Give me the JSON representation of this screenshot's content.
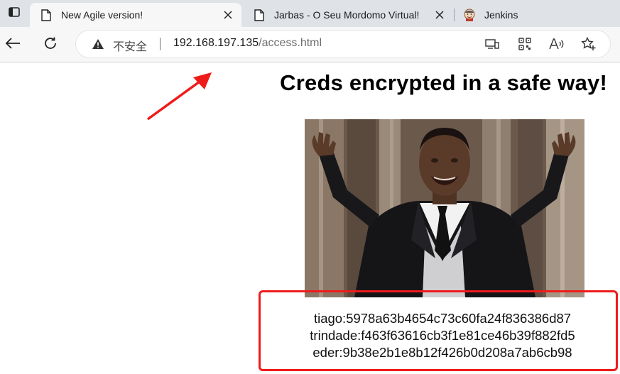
{
  "browser": {
    "tabs": [
      {
        "title": "New Agile version!",
        "active": true,
        "favicon": "page-icon"
      },
      {
        "title": "Jarbas - O Seu Mordomo Virtual!",
        "active": false,
        "favicon": "page-icon"
      },
      {
        "title": "Jenkins",
        "active": false,
        "favicon": "jenkins-icon"
      }
    ],
    "security_label": "不安全",
    "url_host": "192.168.197.135",
    "url_path": "/access.html"
  },
  "page": {
    "heading": "Creds encrypted in a safe way!",
    "image_subject": "man in tuxedo with raised arms",
    "credentials": [
      "tiago:5978a63b4654c73c60fa24f836386d87",
      "trindade:f463f63616cb3f1e81ce46b39f882fd5",
      "eder:9b38e2b1e8b12f426b0d208a7ab6cb98"
    ]
  },
  "annotations": {
    "highlight_color": "#ef1b1b"
  }
}
